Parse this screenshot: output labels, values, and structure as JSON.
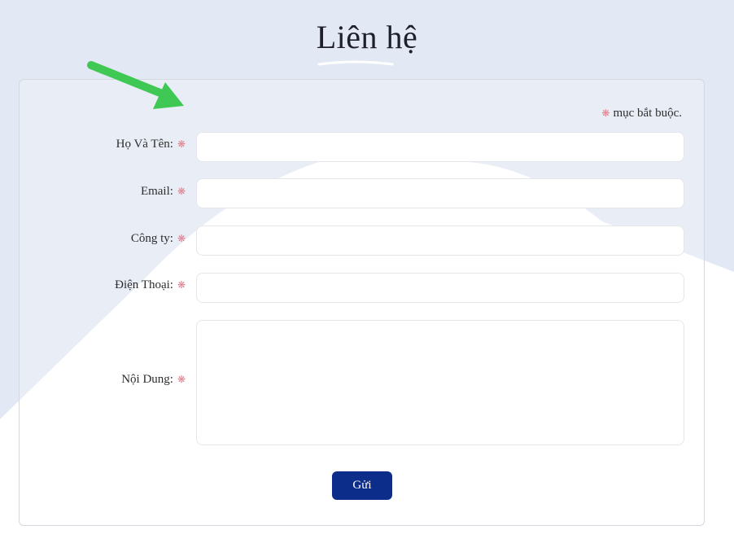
{
  "page": {
    "title": "Liên hệ"
  },
  "colors": {
    "background_shape": "#e3e9f4",
    "accent_arrow": "#3fc853",
    "required_star": "#e07f8d",
    "submit_button": "#0c2d8a"
  },
  "form": {
    "required_note": "mục bắt buộc.",
    "required_symbol": "❋",
    "fields": [
      {
        "label": "Họ Và Tên:",
        "value": "",
        "type": "text"
      },
      {
        "label": "Email:",
        "value": "",
        "type": "email"
      },
      {
        "label": "Công ty:",
        "value": "",
        "type": "text"
      },
      {
        "label": "Điện Thoại:",
        "value": "",
        "type": "tel"
      },
      {
        "label": "Nội Dung:",
        "value": "",
        "type": "textarea"
      }
    ],
    "submit_label": "Gửi"
  }
}
